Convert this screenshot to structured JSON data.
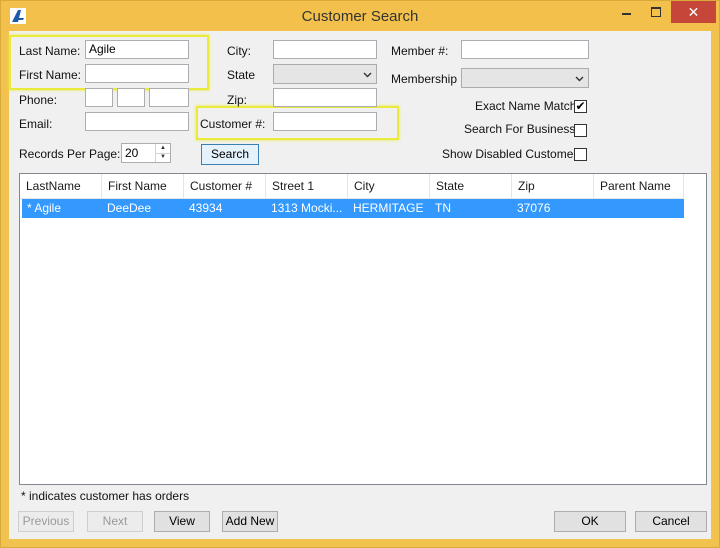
{
  "window": {
    "title": "Customer Search"
  },
  "search": {
    "last_name_label": "Last Name:",
    "last_name_value": "Agile",
    "first_name_label": "First Name:",
    "first_name_value": "",
    "phone_label": "Phone:",
    "email_label": "Email:",
    "city_label": "City:",
    "state_label": "State",
    "zip_label": "Zip:",
    "customer_num_label": "Customer #:",
    "member_num_label": "Member #:",
    "membership_label": "Membership",
    "exact_name_label": "Exact Name Match",
    "exact_name_checked": "✔",
    "search_business_label": "Search For Business",
    "show_disabled_label": "Show Disabled Customer",
    "records_per_page_label": "Records Per Page:",
    "records_per_page_value": "20",
    "search_button": "Search"
  },
  "grid": {
    "columns": [
      "LastName",
      "First Name",
      "Customer #",
      "Street 1",
      "City",
      "State",
      "Zip",
      "Parent Name"
    ],
    "rows": [
      [
        "* Agile",
        "DeeDee",
        "43934",
        "1313 Mocki...",
        "HERMITAGE",
        "TN",
        "37076",
        ""
      ]
    ]
  },
  "footer": {
    "note": "* indicates customer has orders",
    "previous": "Previous",
    "next": "Next",
    "view": "View",
    "add_new": "Add New",
    "ok": "OK",
    "cancel": "Cancel"
  },
  "icons": {
    "app": "app-logo-icon",
    "minimize": "minimize-icon",
    "maximize": "maximize-icon",
    "close": "close-icon"
  },
  "colors": {
    "title_bar": "#f3c14b",
    "selection": "#3399ff",
    "highlight": "#e9ea3b",
    "close": "#c7463a"
  }
}
